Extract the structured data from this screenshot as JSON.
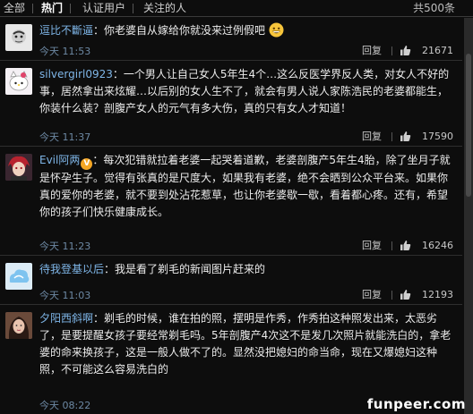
{
  "tabs": {
    "all": "全部",
    "hot": "热门",
    "verified": "认证用户",
    "following": "关注的人"
  },
  "total": "共500条",
  "actions": {
    "reply": "回复"
  },
  "comments": [
    {
      "user": "逗比不斷逼",
      "text": "：你老婆自从嫁给你就没来过例假吧",
      "emoji": "grin-emoji",
      "time": "今天 11:53",
      "likes": "21671"
    },
    {
      "user": "silvergirl0923",
      "text": "：一个男人让自己女人5年生4个…这么反医学界反人类，对女人不好的事，居然拿出来炫耀…以后别的女人生不了，就会有男人说人家陈浩民的老婆都能生，你装什么装？剖腹产女人的元气有多大伤，真的只有女人才知道！",
      "time": "今天 11:37",
      "likes": "17590"
    },
    {
      "user": "Evil阿两",
      "badge": "V",
      "text": "：每次犯错就拉着老婆一起哭着道歉，老婆剖腹产5年生4胎，除了坐月子就是怀孕生子。觉得有张真的是尺度大，如果我有老婆，绝不会晒到公众平台来。如果你真的爱你的老婆，就不要到处沾花惹草，也让你老婆歇一歇，看着都心疼。还有，希望你的孩子们快乐健康成长。",
      "time": "今天 11:23",
      "likes": "16246"
    },
    {
      "user": "待我登基以后",
      "text": "：我是看了剃毛的新闻图片赶来的",
      "time": "今天 11:03",
      "likes": "12193"
    },
    {
      "user": "夕阳西斜啊",
      "text": "：剃毛的时候，谁在拍的照，摆明是作秀，作秀拍这种照发出来，太恶劣了，是要提醒女孩子要经常剃毛吗。5年剖腹产4次这不是发几次照片就能洗白的，拿老婆的命来换孩子，这是一般人做不了的。显然没把媳妇的命当命，现在又爆媳妇这种照，不可能这么容易洗白的",
      "time": "今天 08:22",
      "likes": ""
    }
  ],
  "watermark": "funpeer.com"
}
